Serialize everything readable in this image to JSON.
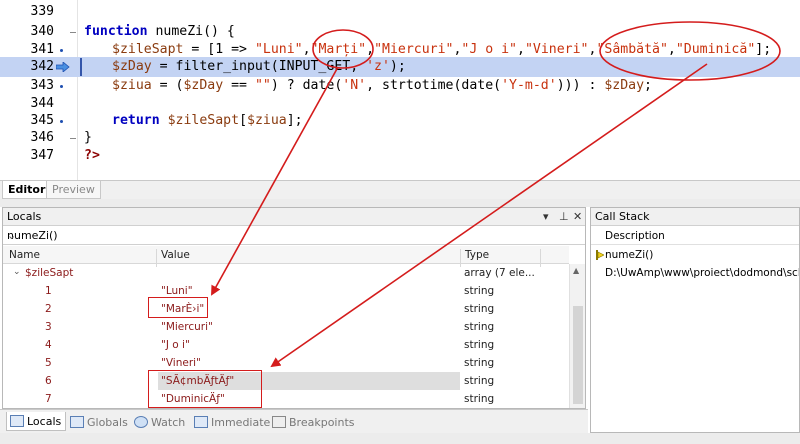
{
  "editor": {
    "lines": [
      {
        "num": "339"
      },
      {
        "num": "340"
      },
      {
        "num": "341"
      },
      {
        "num": "342"
      },
      {
        "num": "343"
      },
      {
        "num": "344"
      },
      {
        "num": "345"
      },
      {
        "num": "346"
      },
      {
        "num": "347"
      }
    ],
    "code": {
      "l340_kw": "function",
      "l340_rest": " numeZi() {",
      "l341_var": "$zileSapt",
      "l341_a": " = [1 => ",
      "l341_s1": "\"Luni\"",
      "l341_c1": ",",
      "l341_s2": "\"Marți\"",
      "l341_c2": ",",
      "l341_s3": "\"Miercuri\"",
      "l341_c3": ",",
      "l341_s4": "\"J o i\"",
      "l341_c4": ",",
      "l341_s5": "\"Vineri\"",
      "l341_c5": ",",
      "l341_s6": "\"Sâmbătă\"",
      "l341_c6": ",",
      "l341_s7": "\"Duminică\"",
      "l341_end": "];",
      "l342_var": "$zDay",
      "l342_a": " = filter_input(INPUT_GET, ",
      "l342_s": "'z'",
      "l342_end": ");",
      "l343_var": "$ziua",
      "l343_a": " = (",
      "l343_v2": "$zDay",
      "l343_b": " == ",
      "l343_s1": "\"\"",
      "l343_c": ") ? date(",
      "l343_s2": "'N'",
      "l343_d": ", strtotime(date(",
      "l343_s3": "'Y-m-d'",
      "l343_e": "))) : ",
      "l343_v3": "$zDay",
      "l343_end": ";",
      "l345_kw": "return",
      "l345_sp": " ",
      "l345_var": "$zileSapt",
      "l345_a": "[",
      "l345_var2": "$ziua",
      "l345_end": "];",
      "l346": "}",
      "l347": "?>"
    },
    "tabs": [
      "Editor",
      "Preview"
    ]
  },
  "locals": {
    "title": "Locals",
    "scope": "numeZi()",
    "columns": [
      "Name",
      "Value",
      "Type"
    ],
    "parent": {
      "name": "$zileSapt",
      "value": "",
      "type": "array (7 ele..."
    },
    "rows": [
      {
        "name": "1",
        "value": "\"Luni\"",
        "type": "string"
      },
      {
        "name": "2",
        "value": "\"MarÈ›i\"",
        "type": "string"
      },
      {
        "name": "3",
        "value": "\"Miercuri\"",
        "type": "string"
      },
      {
        "name": "4",
        "value": "\"J o i\"",
        "type": "string"
      },
      {
        "name": "5",
        "value": "\"Vineri\"",
        "type": "string"
      },
      {
        "name": "6",
        "value": "\"SÃ¢mbÄƒtÄƒ\"",
        "type": "string"
      },
      {
        "name": "7",
        "value": "\"DuminicÄƒ\"",
        "type": "string"
      }
    ]
  },
  "callstack": {
    "title": "Call Stack",
    "column": "Description",
    "rows": [
      "numeZi()",
      "D:\\UwAmp\\www\\proiect\\dodmond\\sched"
    ]
  },
  "bottom_tabs": [
    "Locals",
    "Globals",
    "Watch",
    "Immediate",
    "Breakpoints"
  ],
  "colors": {
    "annotation": "#d41c1c",
    "current_line": "#c3d3f3",
    "keyword": "#0000c0",
    "string": "#c8320e"
  }
}
